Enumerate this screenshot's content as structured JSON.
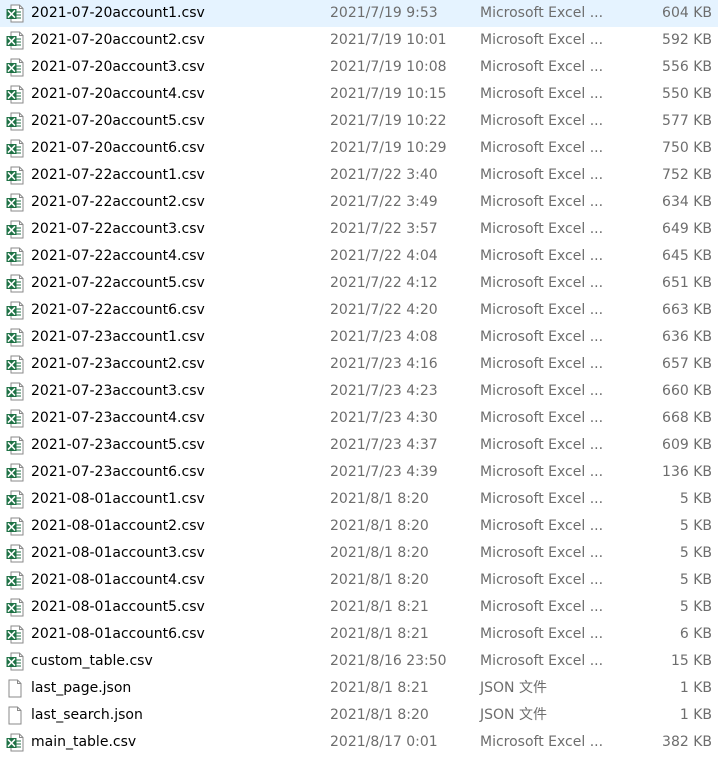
{
  "files": [
    {
      "name": "2021-07-20account1.csv",
      "date": "2021/7/19 9:53",
      "type": "Microsoft Excel ...",
      "size": "604 KB",
      "icon": "excel-csv-icon"
    },
    {
      "name": "2021-07-20account2.csv",
      "date": "2021/7/19 10:01",
      "type": "Microsoft Excel ...",
      "size": "592 KB",
      "icon": "excel-csv-icon"
    },
    {
      "name": "2021-07-20account3.csv",
      "date": "2021/7/19 10:08",
      "type": "Microsoft Excel ...",
      "size": "556 KB",
      "icon": "excel-csv-icon"
    },
    {
      "name": "2021-07-20account4.csv",
      "date": "2021/7/19 10:15",
      "type": "Microsoft Excel ...",
      "size": "550 KB",
      "icon": "excel-csv-icon"
    },
    {
      "name": "2021-07-20account5.csv",
      "date": "2021/7/19 10:22",
      "type": "Microsoft Excel ...",
      "size": "577 KB",
      "icon": "excel-csv-icon"
    },
    {
      "name": "2021-07-20account6.csv",
      "date": "2021/7/19 10:29",
      "type": "Microsoft Excel ...",
      "size": "750 KB",
      "icon": "excel-csv-icon"
    },
    {
      "name": "2021-07-22account1.csv",
      "date": "2021/7/22 3:40",
      "type": "Microsoft Excel ...",
      "size": "752 KB",
      "icon": "excel-csv-icon"
    },
    {
      "name": "2021-07-22account2.csv",
      "date": "2021/7/22 3:49",
      "type": "Microsoft Excel ...",
      "size": "634 KB",
      "icon": "excel-csv-icon"
    },
    {
      "name": "2021-07-22account3.csv",
      "date": "2021/7/22 3:57",
      "type": "Microsoft Excel ...",
      "size": "649 KB",
      "icon": "excel-csv-icon"
    },
    {
      "name": "2021-07-22account4.csv",
      "date": "2021/7/22 4:04",
      "type": "Microsoft Excel ...",
      "size": "645 KB",
      "icon": "excel-csv-icon"
    },
    {
      "name": "2021-07-22account5.csv",
      "date": "2021/7/22 4:12",
      "type": "Microsoft Excel ...",
      "size": "651 KB",
      "icon": "excel-csv-icon"
    },
    {
      "name": "2021-07-22account6.csv",
      "date": "2021/7/22 4:20",
      "type": "Microsoft Excel ...",
      "size": "663 KB",
      "icon": "excel-csv-icon"
    },
    {
      "name": "2021-07-23account1.csv",
      "date": "2021/7/23 4:08",
      "type": "Microsoft Excel ...",
      "size": "636 KB",
      "icon": "excel-csv-icon"
    },
    {
      "name": "2021-07-23account2.csv",
      "date": "2021/7/23 4:16",
      "type": "Microsoft Excel ...",
      "size": "657 KB",
      "icon": "excel-csv-icon"
    },
    {
      "name": "2021-07-23account3.csv",
      "date": "2021/7/23 4:23",
      "type": "Microsoft Excel ...",
      "size": "660 KB",
      "icon": "excel-csv-icon"
    },
    {
      "name": "2021-07-23account4.csv",
      "date": "2021/7/23 4:30",
      "type": "Microsoft Excel ...",
      "size": "668 KB",
      "icon": "excel-csv-icon"
    },
    {
      "name": "2021-07-23account5.csv",
      "date": "2021/7/23 4:37",
      "type": "Microsoft Excel ...",
      "size": "609 KB",
      "icon": "excel-csv-icon"
    },
    {
      "name": "2021-07-23account6.csv",
      "date": "2021/7/23 4:39",
      "type": "Microsoft Excel ...",
      "size": "136 KB",
      "icon": "excel-csv-icon"
    },
    {
      "name": "2021-08-01account1.csv",
      "date": "2021/8/1 8:20",
      "type": "Microsoft Excel ...",
      "size": "5 KB",
      "icon": "excel-csv-icon"
    },
    {
      "name": "2021-08-01account2.csv",
      "date": "2021/8/1 8:20",
      "type": "Microsoft Excel ...",
      "size": "5 KB",
      "icon": "excel-csv-icon"
    },
    {
      "name": "2021-08-01account3.csv",
      "date": "2021/8/1 8:20",
      "type": "Microsoft Excel ...",
      "size": "5 KB",
      "icon": "excel-csv-icon"
    },
    {
      "name": "2021-08-01account4.csv",
      "date": "2021/8/1 8:20",
      "type": "Microsoft Excel ...",
      "size": "5 KB",
      "icon": "excel-csv-icon"
    },
    {
      "name": "2021-08-01account5.csv",
      "date": "2021/8/1 8:21",
      "type": "Microsoft Excel ...",
      "size": "5 KB",
      "icon": "excel-csv-icon"
    },
    {
      "name": "2021-08-01account6.csv",
      "date": "2021/8/1 8:21",
      "type": "Microsoft Excel ...",
      "size": "6 KB",
      "icon": "excel-csv-icon"
    },
    {
      "name": "custom_table.csv",
      "date": "2021/8/16 23:50",
      "type": "Microsoft Excel ...",
      "size": "15 KB",
      "icon": "excel-csv-icon"
    },
    {
      "name": "last_page.json",
      "date": "2021/8/1 8:21",
      "type": "JSON 文件",
      "size": "1 KB",
      "icon": "blank-file-icon"
    },
    {
      "name": "last_search.json",
      "date": "2021/8/1 8:20",
      "type": "JSON 文件",
      "size": "1 KB",
      "icon": "blank-file-icon"
    },
    {
      "name": "main_table.csv",
      "date": "2021/8/17 0:01",
      "type": "Microsoft Excel ...",
      "size": "382 KB",
      "icon": "excel-csv-icon"
    }
  ],
  "colors": {
    "excel_green": "#1e7145",
    "secondary_text": "#6d6d6d",
    "primary_text": "#000000"
  }
}
